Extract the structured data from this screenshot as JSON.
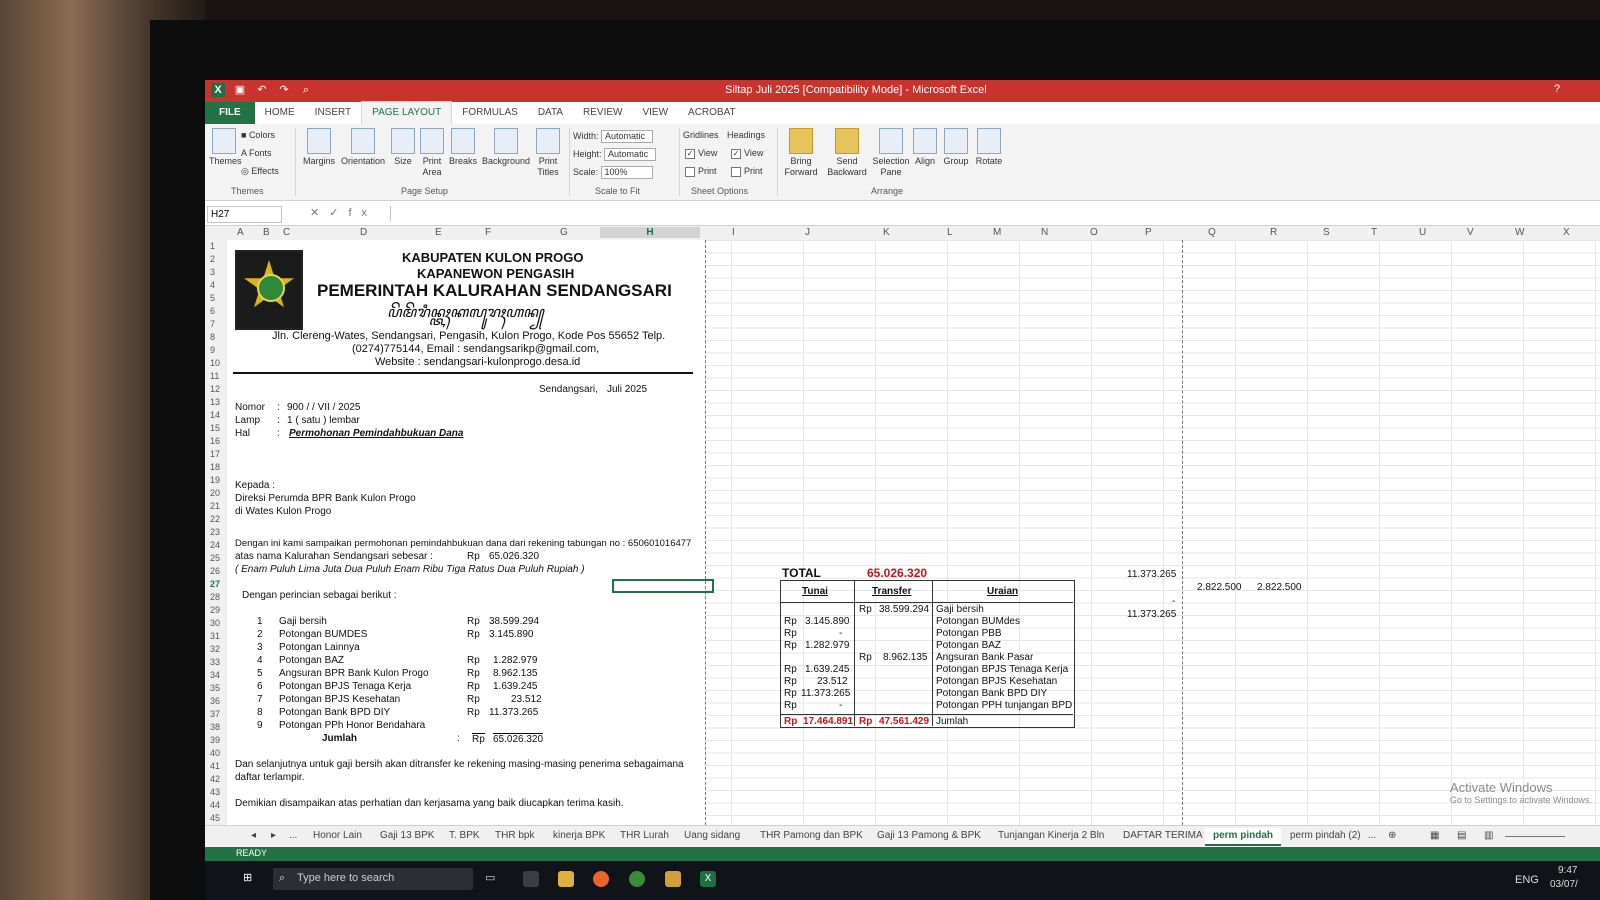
{
  "window": {
    "title": "Siltap Juli 2025  [Compatibility Mode] - Microsoft Excel",
    "help": "?"
  },
  "ribbon_tabs": [
    "FILE",
    "HOME",
    "INSERT",
    "PAGE LAYOUT",
    "FORMULAS",
    "DATA",
    "REVIEW",
    "VIEW",
    "ACROBAT"
  ],
  "ribbon": {
    "themes": "Themes",
    "colors": "Colors",
    "fonts": "Fonts",
    "effects": "Effects",
    "margins": "Margins",
    "orientation": "Orientation",
    "size": "Size",
    "print_area": "Print Area",
    "breaks": "Breaks",
    "background": "Background",
    "print_titles": "Print Titles",
    "width_label": "Width:",
    "width_value": "Automatic",
    "height_label": "Height:",
    "height_value": "Automatic",
    "scale_label": "Scale:",
    "scale_value": "100%",
    "gridlines": "Gridlines",
    "headings": "Headings",
    "view": "View",
    "print": "Print",
    "bring_forward": "Bring Forward",
    "send_backward": "Send Backward",
    "selection_pane": "Selection Pane",
    "align": "Align",
    "group": "Group",
    "rotate": "Rotate",
    "groups": {
      "themes": "Themes",
      "page_setup": "Page Setup",
      "scale_to_fit": "Scale to Fit",
      "sheet_options": "Sheet Options",
      "arrange": "Arrange"
    }
  },
  "formula_bar": {
    "name_box": "H27",
    "content": ""
  },
  "columns": [
    "A",
    "B",
    "C",
    "D",
    "E",
    "F",
    "G",
    "H",
    "I",
    "J",
    "K",
    "L",
    "M",
    "N",
    "O",
    "P",
    "Q",
    "R",
    "S",
    "T",
    "U",
    "V",
    "W",
    "X"
  ],
  "rows": [
    "1",
    "2",
    "3",
    "4",
    "5",
    "6",
    "7",
    "8",
    "9",
    "10",
    "11",
    "12",
    "13",
    "14",
    "15",
    "16",
    "17",
    "18",
    "19",
    "20",
    "21",
    "22",
    "23",
    "24",
    "25",
    "26",
    "27",
    "28",
    "29",
    "30",
    "31",
    "32",
    "33",
    "34",
    "35",
    "36",
    "37",
    "38",
    "39",
    "40",
    "41",
    "42",
    "43",
    "44",
    "45"
  ],
  "letterhead": {
    "line1": "KABUPATEN KULON PROGO",
    "line2": "KAPANEWON PENGASIH",
    "line3": "PEMERINTAH KALURAHAN SENDANGSARI",
    "line4": "ꦥꦼꦩꦼꦫꦶꦤ꧀ꦠꦃꦏꦭꦸꦫꦃꦲꦤ꧀ꦱꦼꦤ꧀ꦢꦁꦱ�super",
    "addr1": "Jln. Clereng-Wates, Sendangsari, Pengasih, Kulon Progo, Kode Pos 55652 Telp.",
    "addr2": "(0274)775144, Email : sendangsarikp@gmail.com,",
    "addr3": "Website : sendangsari-kulonprogo.desa.id"
  },
  "letter": {
    "place_date_label": "Sendangsari,",
    "place_date": "Juli 2025",
    "nomor_label": "Nomor",
    "nomor": "900 /    / VII / 2025",
    "lamp_label": "Lamp",
    "lamp": "1 ( satu ) lembar",
    "hal_label": "Hal",
    "hal": "Permohonan Pemindahbukuan Dana",
    "colon": ":",
    "kepada": "Kepada :",
    "to1": "Direksi Perumda BPR Bank Kulon Progo",
    "to2": "di Wates Kulon Progo",
    "p1": "Dengan ini kami sampaikan permohonan pemindahbukuan dana dari rekening tabungan no : 650601016477",
    "p2": "atas nama Kalurahan Sendangsari sebesar :",
    "p2_rp": "Rp",
    "p2_amount": "65.026.320",
    "p3": "( Enam Puluh Lima Juta Dua Puluh Enam Ribu Tiga Ratus Dua Puluh Rupiah )",
    "p4": "Dengan perincian sebagai berikut :",
    "items": [
      {
        "no": "1",
        "label": "Gaji bersih",
        "rp": "Rp",
        "amount": "38.599.294"
      },
      {
        "no": "2",
        "label": "Potongan BUMDES",
        "rp": "Rp",
        "amount": "3.145.890"
      },
      {
        "no": "3",
        "label": "Potongan Lainnya",
        "rp": "",
        "amount": ""
      },
      {
        "no": "4",
        "label": "Potongan BAZ",
        "rp": "Rp",
        "amount": "1.282.979"
      },
      {
        "no": "5",
        "label": "Angsuran BPR Bank Kulon Progo",
        "rp": "Rp",
        "amount": "8.962.135"
      },
      {
        "no": "6",
        "label": "Potongan BPJS Tenaga Kerja",
        "rp": "Rp",
        "amount": "1.639.245"
      },
      {
        "no": "7",
        "label": "Potongan BPJS Kesehatan",
        "rp": "Rp",
        "amount": "23.512"
      },
      {
        "no": "8",
        "label": "Potongan Bank BPD DIY",
        "rp": "Rp",
        "amount": "11.373.265"
      },
      {
        "no": "9",
        "label": "Potongan PPh Honor Bendahara",
        "rp": "",
        "amount": ""
      }
    ],
    "jumlah_label": "Jumlah",
    "jumlah_rp": "Rp",
    "jumlah_amount": "65.026.320",
    "p5": "Dan selanjutnya untuk gaji bersih akan ditransfer ke rekening masing-masing penerima sebagaimana",
    "p6": "daftar terlampir.",
    "p7": "Demikian disampaikan atas perhatian dan kerjasama yang baik diucapkan terima kasih."
  },
  "summary": {
    "total_label": "TOTAL",
    "total_value": "65.026.320",
    "headers": [
      "Tunai",
      "Transfer",
      "Uraian"
    ],
    "rows": [
      {
        "tunai_rp": "",
        "tunai": "",
        "transfer_rp": "Rp",
        "transfer": "38.599.294",
        "uraian": "Gaji bersih"
      },
      {
        "tunai_rp": "Rp",
        "tunai": "3.145.890",
        "transfer_rp": "",
        "transfer": "",
        "uraian": "Potongan BUMdes"
      },
      {
        "tunai_rp": "Rp",
        "tunai": "-",
        "transfer_rp": "",
        "transfer": "",
        "uraian": "Potongan PBB"
      },
      {
        "tunai_rp": "Rp",
        "tunai": "1.282.979",
        "transfer_rp": "",
        "transfer": "",
        "uraian": "Potongan BAZ"
      },
      {
        "tunai_rp": "",
        "tunai": "",
        "transfer_rp": "Rp",
        "transfer": "8.962.135",
        "uraian": "Angsuran Bank Pasar"
      },
      {
        "tunai_rp": "Rp",
        "tunai": "1.639.245",
        "transfer_rp": "",
        "transfer": "",
        "uraian": "Potongan BPJS Tenaga Kerja"
      },
      {
        "tunai_rp": "Rp",
        "tunai": "23.512",
        "transfer_rp": "",
        "transfer": "",
        "uraian": "Potongan BPJS Kesehatan"
      },
      {
        "tunai_rp": "Rp",
        "tunai": "11.373.265",
        "transfer_rp": "",
        "transfer": "",
        "uraian": "Potongan Bank BPD DIY"
      },
      {
        "tunai_rp": "Rp",
        "tunai": "-",
        "transfer_rp": "",
        "transfer": "",
        "uraian": "Potongan PPH tunjangan BPD"
      }
    ],
    "jumlah": {
      "tunai_rp": "Rp",
      "tunai": "17.464.891",
      "transfer_rp": "Rp",
      "transfer": "47.561.429",
      "uraian": "Jumlah"
    },
    "side_p26": "11.373.265",
    "side_p29": "11.373.265",
    "side_q27": "2.822.500",
    "side_r27": "2.822.500",
    "side_dash": "-"
  },
  "sheet_tabs": [
    "Honor Lain",
    "Gaji 13 BPK",
    "T. BPK",
    "THR bpk",
    "kinerja BPK",
    "THR Lurah",
    "Uang sidang",
    "THR Pamong dan BPK",
    "Gaji 13 Pamong & BPK",
    "Tunjangan Kinerja 2 Bln",
    "DAFTAR TERIMA",
    "perm pindah",
    "perm pindah (2)",
    "..."
  ],
  "status": {
    "ready": "READY"
  },
  "watermark": {
    "title": "Activate Windows",
    "sub": "Go to Settings to activate Windows."
  },
  "taskbar": {
    "search_placeholder": "Type here to search",
    "lang": "ENG",
    "time": "9:47",
    "date": "03/07/"
  },
  "colors": {
    "excel_green": "#217346",
    "title_red": "#c8332b",
    "value_red": "#c0161d"
  }
}
